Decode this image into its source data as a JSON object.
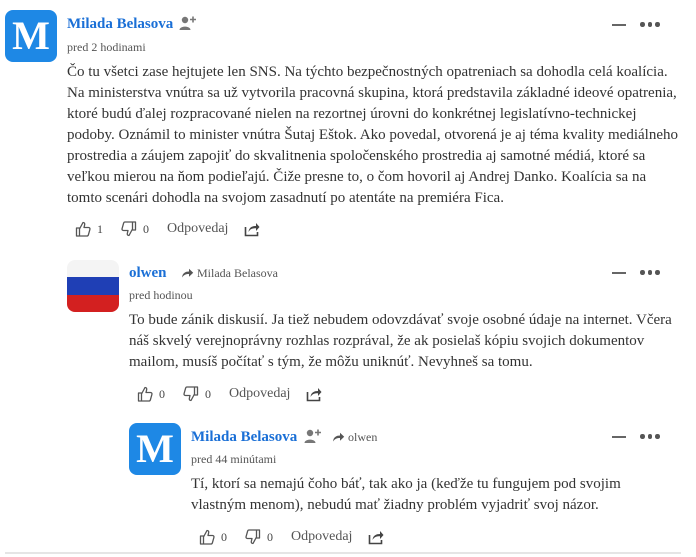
{
  "comments": [
    {
      "author": "Milada Belasova",
      "avatar_letter": "M",
      "time": "pred 2 hodinami",
      "text": "Čo tu všetci zase hejtujete len SNS. Na týchto bezpečnostných opatreniach sa dohodla celá koalícia. Na ministerstva vnútra sa už vytvorila pracovná skupina, ktorá predstavila základné ideové opatrenia, ktoré budú ďalej rozpracované nielen na rezortnej úrovni do konkrétnej legislatívno-technickej podoby. Oznámil to minister vnútra Šutaj Eštok. Ako povedal, otvorená je aj téma kvality mediálneho prostredia a záujem zapojiť do skvalitnenia spoločenského prostredia aj samotné médiá, ktoré sa veľkou mierou na ňom podieľajú. Čiže presne to, o čom hovoril aj Andrej Danko. Koalícia sa na tomto scenári dohodla na svojom zasadnutí po atentáte na premiéra Fica.",
      "likes": "1",
      "dislikes": "0",
      "reply_label": "Odpovedaj"
    },
    {
      "author": "olwen",
      "reply_to": "Milada Belasova",
      "time": "pred hodinou",
      "text": "To bude zánik diskusií. Ja tiež nebudem odovzdávať svoje osobné údaje na internet. Včera náš skvelý verejnoprávny rozhlas rozprával, že ak posielaš kópiu svojich dokumentov mailom, musíš počítať s tým, že môžu uniknúť. Nevyhneš sa tomu.",
      "likes": "0",
      "dislikes": "0",
      "reply_label": "Odpovedaj"
    },
    {
      "author": "Milada Belasova",
      "avatar_letter": "M",
      "reply_to": "olwen",
      "time": "pred 44 minútami",
      "text": "Tí, ktorí sa nemajú čoho báť, tak ako ja (keďže tu fungujem pod svojim vlastným menom), nebudú mať žiadny problém vyjadriť svoj názor.",
      "likes": "0",
      "dislikes": "0",
      "reply_label": "Odpovedaj"
    }
  ],
  "colors": {
    "accent": "#1a6fd6",
    "avatar_bg": "#1e88e5",
    "flag_white": "#f4f4f4",
    "flag_blue": "#1f3fb5",
    "flag_red": "#d32020"
  },
  "icons": [
    "add-user-icon",
    "reply-arrow-icon",
    "thumbs-up-icon",
    "thumbs-down-icon",
    "share-icon",
    "collapse-icon",
    "more-icon"
  ]
}
